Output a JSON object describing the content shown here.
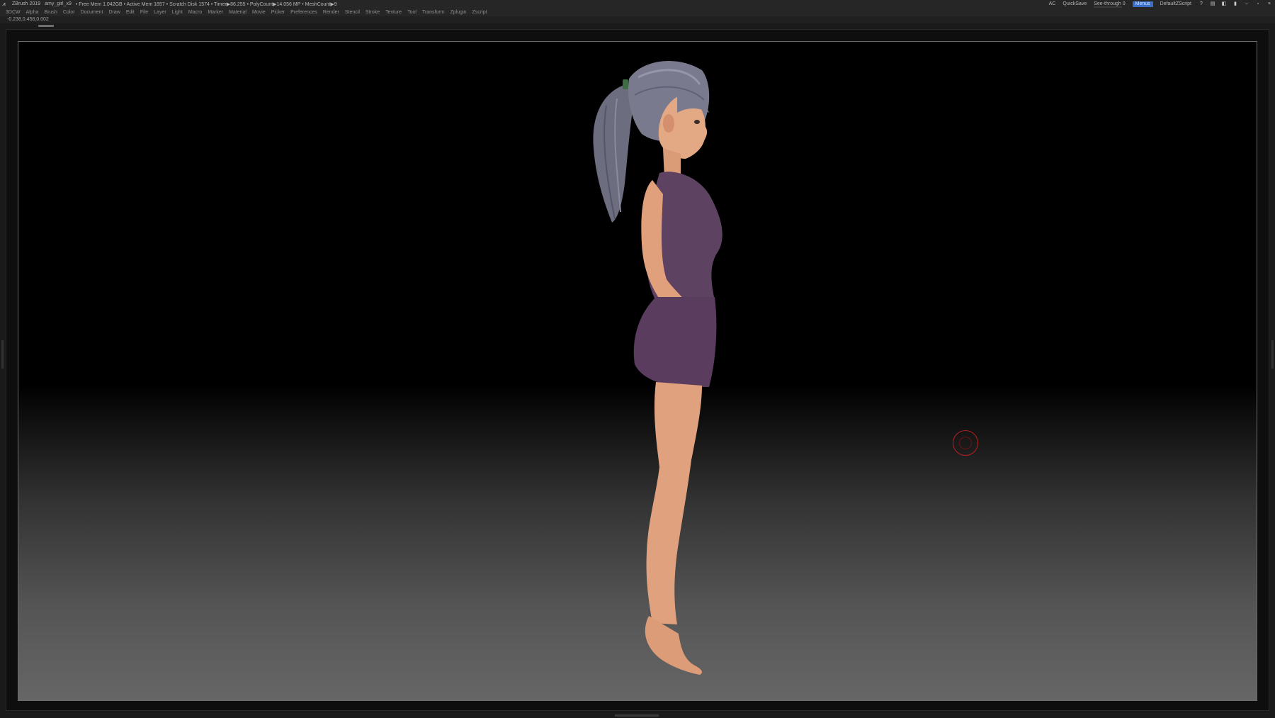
{
  "titlebar": {
    "app": "ZBrush 2019",
    "file": "amy_girl_x9",
    "stats": "• Free Mem 1.042GB • Active Mem 1857 • Scratch Disk 1574 • Timer▶86.255 • PolyCount▶14.056 MP • MeshCount▶9",
    "ac": "AC",
    "quicksave": "QuickSave",
    "see_through_label": "See-through",
    "see_through_value": "0",
    "see_through_fraction": 0,
    "menus_button": "Menus",
    "default_script": "DefaultZScript"
  },
  "menu": [
    "3DCW",
    "Alpha",
    "Brush",
    "Color",
    "Document",
    "Draw",
    "Edit",
    "File",
    "Layer",
    "Light",
    "Macro",
    "Marker",
    "Material",
    "Movie",
    "Picker",
    "Preferences",
    "Render",
    "Stencil",
    "Stroke",
    "Texture",
    "Tool",
    "Transform",
    "Zplugin",
    "Zscript"
  ],
  "coords": "-0.238,0.458,0.002",
  "icons": [
    "zbrush-logo-icon",
    "help-icon",
    "tray-icon",
    "palette-icon",
    "lock-icon",
    "minimize-icon",
    "restore-icon",
    "close-icon"
  ],
  "colors": {
    "accent": "#3b6fc4",
    "brush_cursor": "#b52222",
    "dress": "#5c4060",
    "skin": "#e0a27e",
    "hair": "#7a7a8c"
  }
}
